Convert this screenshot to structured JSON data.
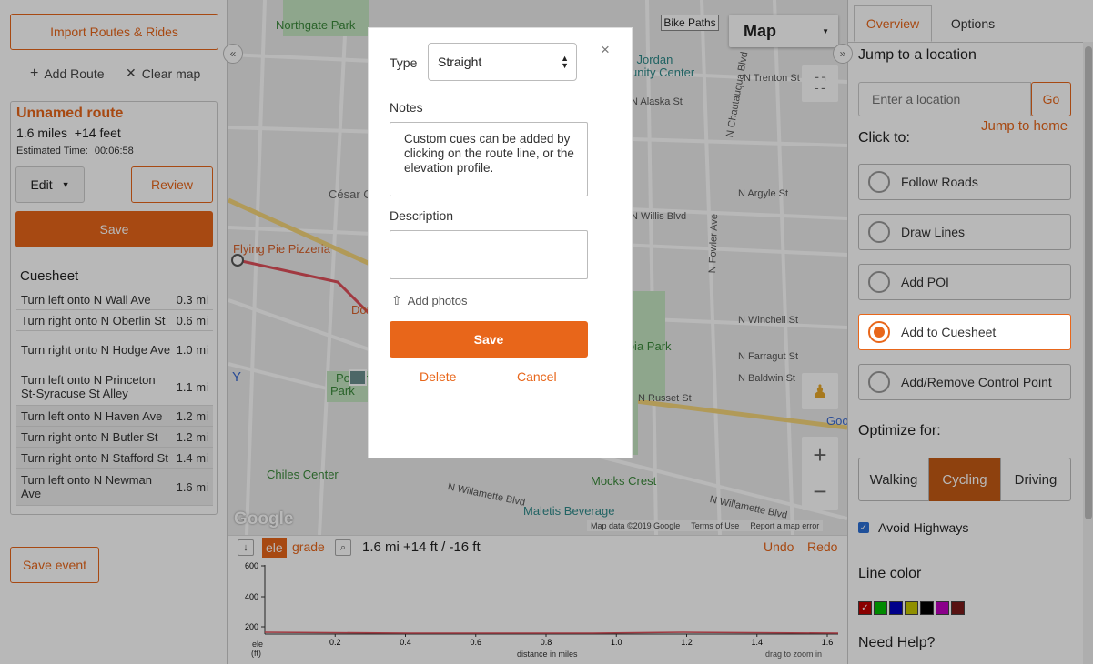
{
  "left": {
    "import_btn": "Import Routes & Rides",
    "add_route": "Add Route",
    "clear_map": "Clear map",
    "route_name": "Unnamed route",
    "route_stats": "1.6 miles  +14 feet",
    "est_time_label": "Estimated Time:",
    "est_time_value": "00:06:58",
    "edit_btn": "Edit",
    "review_btn": "Review",
    "save_btn": "Save",
    "cuesheet_title": "Cuesheet",
    "cues": [
      {
        "text": "Turn left onto N Wall Ave",
        "dist": "0.3 mi"
      },
      {
        "text": "Turn right onto N Oberlin St",
        "dist": "0.6 mi"
      },
      {
        "text": "Turn right onto N Hodge Ave",
        "dist": "1.0 mi"
      },
      {
        "text": "Turn left onto N Princeton St-Syracuse St Alley",
        "dist": "1.1 mi"
      },
      {
        "text": "Turn left onto N Haven Ave",
        "dist": "1.2 mi"
      },
      {
        "text": "Turn right onto N Butler St",
        "dist": "1.2 mi"
      },
      {
        "text": "Turn right onto N Stafford St",
        "dist": "1.4 mi"
      },
      {
        "text": "Turn left onto N Newman Ave",
        "dist": "1.6 mi"
      }
    ],
    "save_event": "Save event"
  },
  "map": {
    "type_select": "Map",
    "bike_paths": "Bike Paths",
    "labels": {
      "northgate": "Northgate Park",
      "charles": "rles Jordan",
      "community": "nmunity Center",
      "cesar": "César Ch",
      "flying_pie": "Flying Pie Pizzeria",
      "portsmouth": "Portsm",
      "park": "Park",
      "dom": "Dom",
      "columbia": "mbia Park",
      "chiles": "Chiles Center",
      "mocks": "Mocks Crest",
      "maletis": "Maletis Beverage",
      "willamette": "N Willamette Blvd",
      "willamette2": "N Willamette Blvd",
      "willis": "N Willis Blvd",
      "winchell": "N Winchell St",
      "farragut": "N Farragut St",
      "baldwin": "N Baldwin St",
      "russet": "N Russet St",
      "trenton": "N Trenton St",
      "alaska": "N Alaska St",
      "argyle": "N Argyle St",
      "chautauqua": "N Chautauqua Blvd",
      "fowler": "N Fowler Ave",
      "google": "Google",
      "goo": "Goo",
      "y": "Y",
      "attribution": "Map data ©2019 Google",
      "terms": "Terms of Use",
      "report": "Report a map error"
    }
  },
  "modal": {
    "type_label": "Type",
    "type_value": "Straight",
    "notes_label": "Notes",
    "notes_value": "Custom cues can be added by clicking on the route line, or the elevation profile.",
    "description_label": "Description",
    "add_photos": "Add photos",
    "save": "Save",
    "delete": "Delete",
    "cancel": "Cancel",
    "close": "×"
  },
  "elevation": {
    "ele": "ele",
    "grade": "grade",
    "summary": "1.6 mi +14 ft / -16 ft",
    "undo": "Undo",
    "redo": "Redo",
    "y_ticks": [
      "600",
      "400",
      "200"
    ],
    "x_ticks": [
      "0.2",
      "0.4",
      "0.6",
      "0.8",
      "1.0",
      "1.2",
      "1.4",
      "1.6"
    ],
    "ylabel": "ele",
    "yunit": "(ft)",
    "xlabel": "distance in miles",
    "drag_hint": "drag to zoom in"
  },
  "right": {
    "tabs": [
      "Overview",
      "Options"
    ],
    "jump_title": "Jump to a location",
    "location_placeholder": "Enter a location",
    "go": "Go",
    "jump_home": "Jump to home",
    "click_to": "Click to:",
    "options": [
      "Follow Roads",
      "Draw Lines",
      "Add POI",
      "Add to Cuesheet",
      "Add/Remove Control Point"
    ],
    "optimize_title": "Optimize for:",
    "modes": [
      "Walking",
      "Cycling",
      "Driving"
    ],
    "avoid_highways": "Avoid Highways",
    "line_color_title": "Line color",
    "colors": [
      "#c00000",
      "#00c000",
      "#0000c0",
      "#c8c800",
      "#000000",
      "#c000c0",
      "#7a1a1a"
    ],
    "need_help": "Need Help?"
  },
  "colors": {
    "accent": "#e8661a",
    "route": "#e0505a"
  }
}
